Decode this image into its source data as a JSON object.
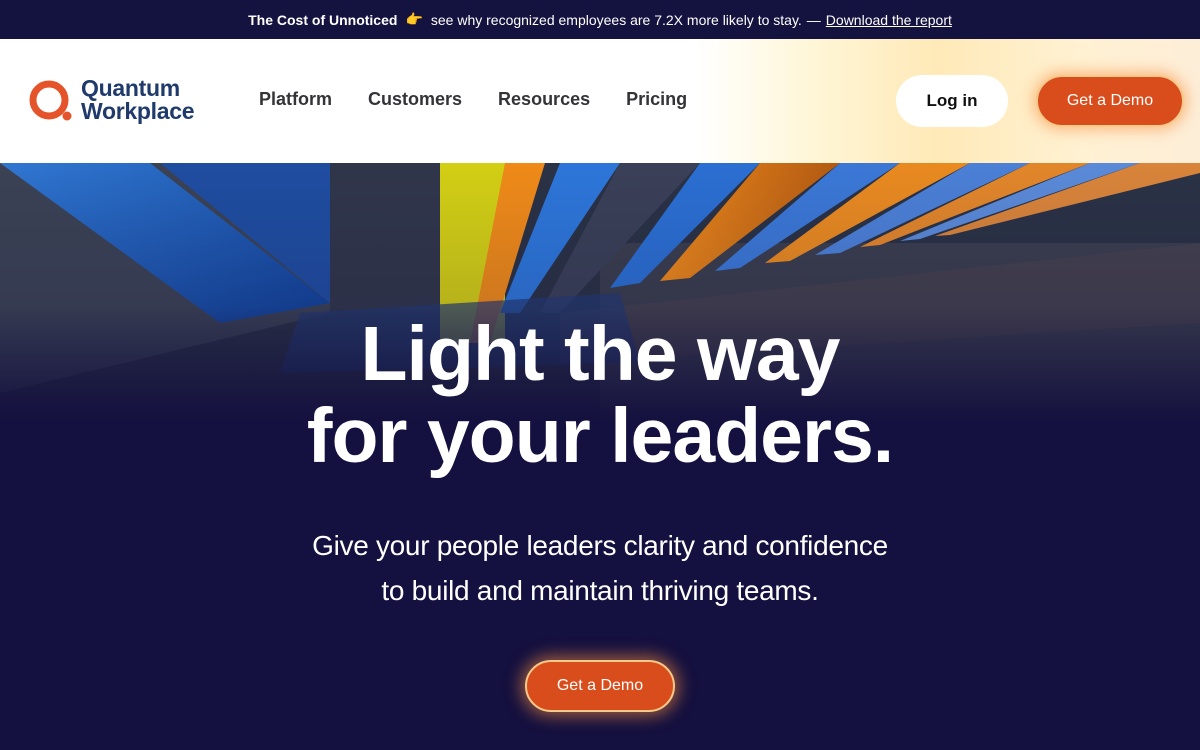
{
  "announcement": {
    "bold_text": "The Cost of Unnoticed",
    "emoji": "👉",
    "text": "see why recognized employees are 7.2X more likely to stay.",
    "dash": "—",
    "link_text": "Download the report"
  },
  "header": {
    "logo": {
      "line1": "Quantum",
      "line2": "Workplace",
      "icon": "quantum-q-logo-icon"
    },
    "nav": [
      {
        "label": "Platform"
      },
      {
        "label": "Customers"
      },
      {
        "label": "Resources"
      },
      {
        "label": "Pricing"
      }
    ],
    "login_label": "Log in",
    "demo_label": "Get a Demo"
  },
  "hero": {
    "title_line1": "Light the way",
    "title_line2": "for your leaders.",
    "subtitle_line1": "Give your people leaders clarity and confidence",
    "subtitle_line2": "to build and maintain thriving teams.",
    "cta_label": "Get a Demo"
  },
  "colors": {
    "brand_orange": "#d94d1c",
    "brand_navy": "#1f3a6b",
    "hero_background": "#14103f",
    "announcement_background": "#14123f"
  }
}
